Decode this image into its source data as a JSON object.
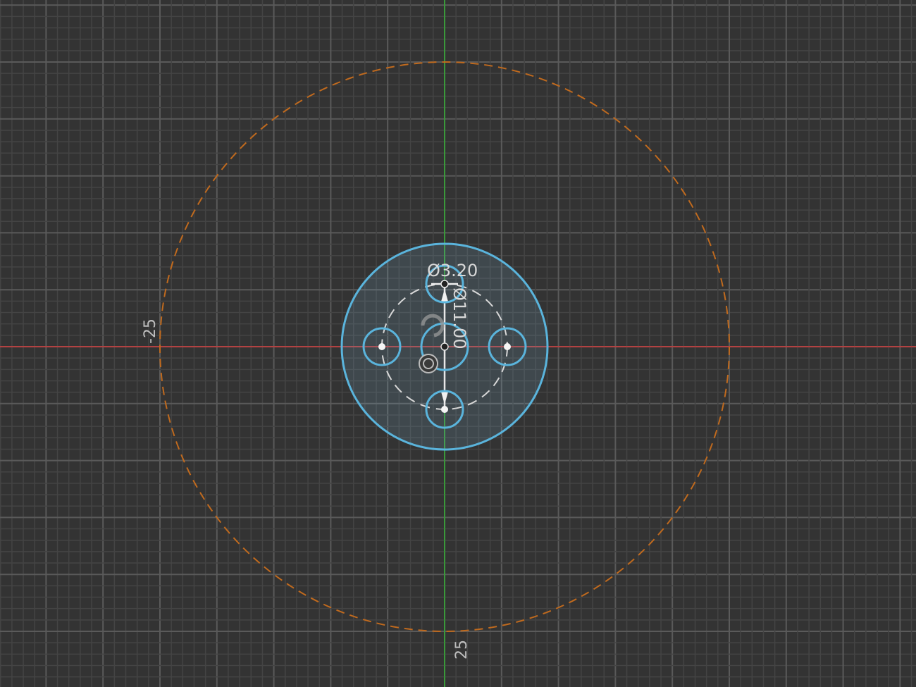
{
  "sketch": {
    "dimensions": {
      "hole_diameter": "Ø3.20",
      "pattern_diameter": "Ø11.00"
    },
    "axis_labels": {
      "x_negative": "-25",
      "y_positive": "25"
    },
    "colors": {
      "background": "#333333",
      "x_axis": "#d03a3a",
      "y_axis": "#2fae2f",
      "profile": "#5ab4dc",
      "construction": "#c06a1e"
    }
  }
}
